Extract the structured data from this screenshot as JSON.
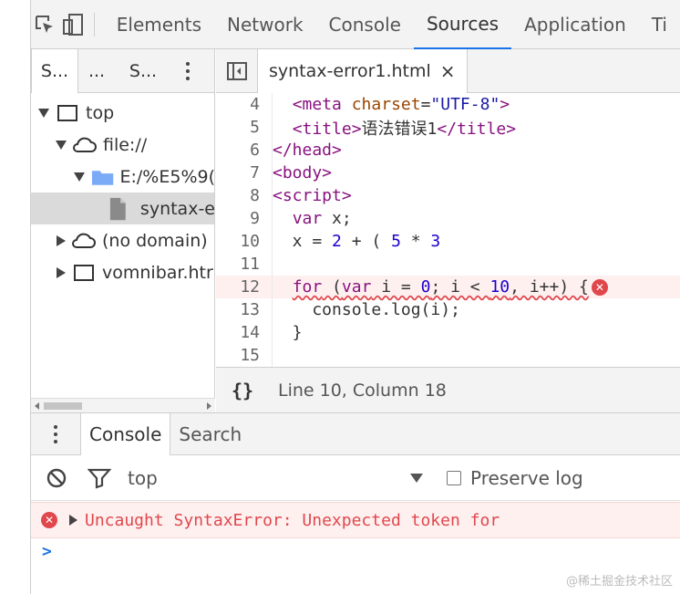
{
  "toolbar": {
    "tabs": [
      "Elements",
      "Network",
      "Console",
      "Sources",
      "Application",
      "Ti"
    ],
    "active_tab": "Sources"
  },
  "navigator": {
    "tabs": [
      "S...",
      "...",
      "S..."
    ],
    "tree": [
      {
        "label": "top",
        "icon": "frame-icon",
        "expanded": true
      },
      {
        "label": "file://",
        "icon": "cloud-icon",
        "expanded": true
      },
      {
        "label": "E:/%E5%9(",
        "icon": "folder-icon",
        "expanded": true
      },
      {
        "label": "syntax-e",
        "icon": "file-icon",
        "selected": true
      },
      {
        "label": "(no domain)",
        "icon": "cloud-icon",
        "expanded": false
      },
      {
        "label": "vomnibar.htr",
        "icon": "frame-icon",
        "expanded": false
      }
    ]
  },
  "editor": {
    "file_tab": "syntax-error1.html",
    "close_glyph": "×",
    "line_numbers": [
      "4",
      "5",
      "6",
      "7",
      "8",
      "9",
      "10",
      "11",
      "12",
      "13",
      "14",
      "15"
    ],
    "status": {
      "braces": "{}",
      "position": "Line 10, Column 18"
    }
  },
  "drawer": {
    "tabs": [
      "Console",
      "Search"
    ],
    "context": "top",
    "preserve_log": "Preserve log",
    "error_message": "Uncaught SyntaxError: Unexpected token for",
    "prompt": ">"
  },
  "watermark": "@稀土掘金技术社区",
  "colors": {
    "accent": "#1a73e8",
    "error": "#e0474c",
    "error_bg": "#fff0f0",
    "panel_bg": "#f3f3f3",
    "tag": "#881280",
    "attr": "#994500",
    "string": "#1a1aa6",
    "number": "#1c00cf",
    "folder": "#7baaf7"
  }
}
